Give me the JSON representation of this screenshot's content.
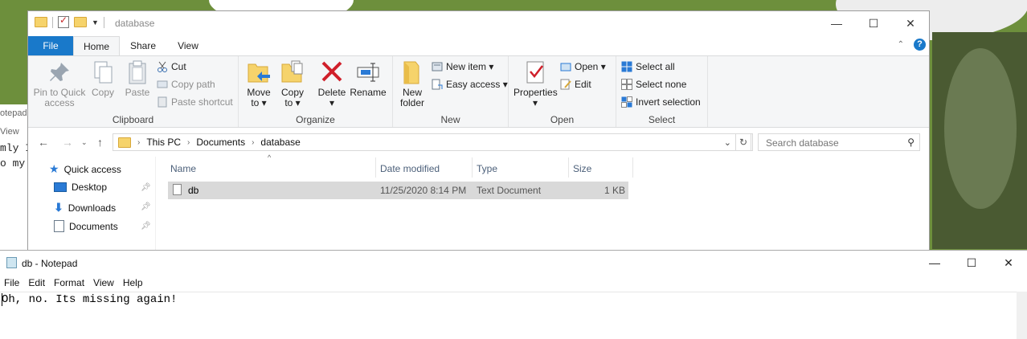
{
  "background": {
    "left_fragments": [
      "otepad",
      "View",
      "mly I",
      "o my"
    ]
  },
  "explorer": {
    "title": "database",
    "window_buttons": {
      "minimize": "—",
      "maximize": "☐",
      "close": "✕"
    },
    "tabs": [
      "File",
      "Home",
      "Share",
      "View"
    ],
    "help": "?",
    "ribbon": {
      "clipboard": {
        "label": "Clipboard",
        "pin_line1": "Pin to Quick",
        "pin_line2": "access",
        "copy": "Copy",
        "paste": "Paste",
        "cut": "Cut",
        "copy_path": "Copy path",
        "paste_shortcut": "Paste shortcut"
      },
      "organize": {
        "label": "Organize",
        "move_line1": "Move",
        "move_line2": "to ▾",
        "copy_line1": "Copy",
        "copy_line2": "to ▾",
        "delete_line1": "Delete",
        "delete_line2": "▾",
        "rename": "Rename"
      },
      "new": {
        "label": "New",
        "folder_line1": "New",
        "folder_line2": "folder",
        "new_item": "New item ▾",
        "easy_access": "Easy access ▾"
      },
      "open": {
        "label": "Open",
        "properties_line1": "Properties",
        "properties_line2": "▾",
        "open": "Open ▾",
        "edit": "Edit"
      },
      "select": {
        "label": "Select",
        "select_all": "Select all",
        "select_none": "Select none",
        "invert": "Invert selection"
      }
    },
    "address": {
      "crumbs": [
        "This PC",
        "Documents",
        "database"
      ],
      "search_placeholder": "Search database"
    },
    "nav": [
      {
        "label": "Quick access"
      },
      {
        "label": "Desktop"
      },
      {
        "label": "Downloads"
      },
      {
        "label": "Documents"
      }
    ],
    "columns": {
      "name": "Name",
      "date": "Date modified",
      "type": "Type",
      "size": "Size"
    },
    "files": [
      {
        "name": "db",
        "date": "11/25/2020 8:14 PM",
        "type": "Text Document",
        "size": "1 KB"
      }
    ]
  },
  "notepad": {
    "title": "db - Notepad",
    "window_buttons": {
      "minimize": "—",
      "maximize": "☐",
      "close": "✕"
    },
    "menu": [
      "File",
      "Edit",
      "Format",
      "View",
      "Help"
    ],
    "content": "Oh, no. Its missing again!"
  },
  "colors": {
    "accent": "#1979ca",
    "selection": "#d9d9d9",
    "folder": "#f6d36b"
  }
}
